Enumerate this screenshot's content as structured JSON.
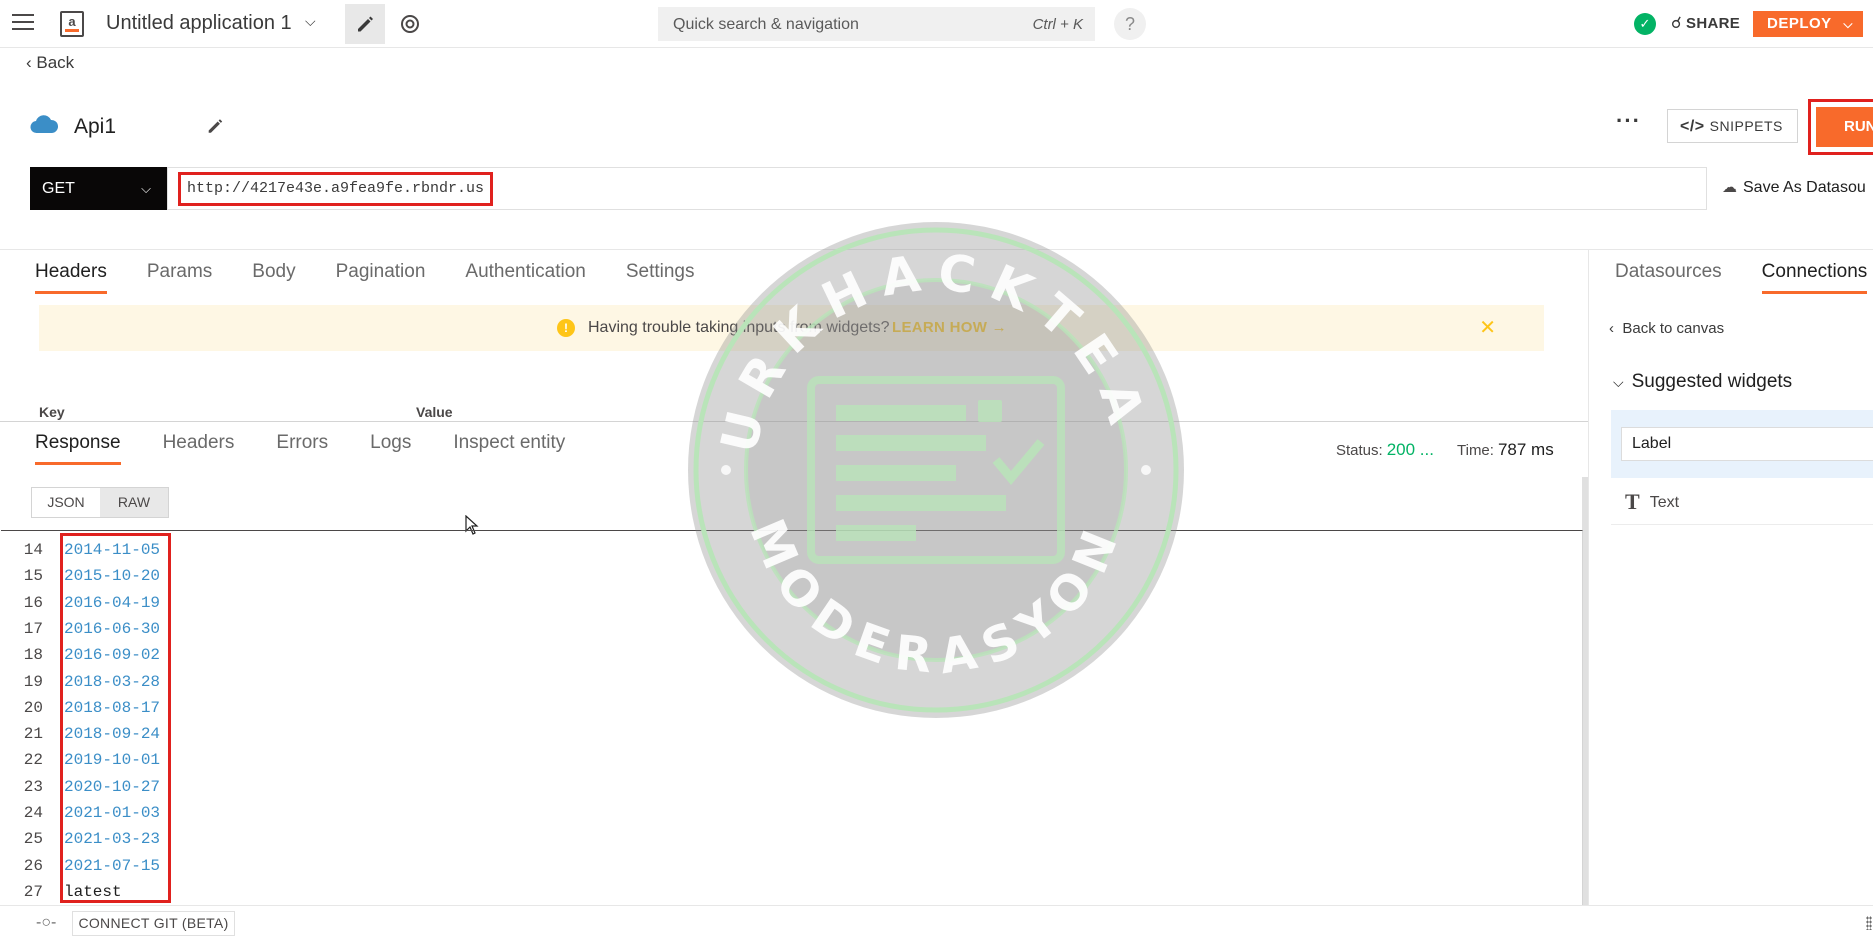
{
  "topbar": {
    "app_title": "Untitled application 1",
    "search_placeholder": "Quick search & navigation",
    "search_shortcut": "Ctrl + K",
    "help_label": "?",
    "share_label": "SHARE",
    "deploy_label": "DEPLOY"
  },
  "nav": {
    "back_label": "Back"
  },
  "api": {
    "name": "Api1",
    "snippets_label": "SNIPPETS",
    "run_label": "RUN",
    "method": "GET",
    "url": "http://4217e43e.a9fea9fe.rbndr.us",
    "save_datasource_label": "Save As Datasou"
  },
  "request": {
    "tabs": [
      "Headers",
      "Params",
      "Body",
      "Pagination",
      "Authentication",
      "Settings"
    ],
    "active_tab": "Headers",
    "banner": {
      "text": "Having trouble taking inputs from widgets?",
      "link": "LEARN HOW →"
    },
    "kv_headers": {
      "key": "Key",
      "value": "Value"
    }
  },
  "response": {
    "tabs": [
      "Response",
      "Headers",
      "Errors",
      "Logs",
      "Inspect entity"
    ],
    "active_tab": "Response",
    "status_label": "Status:",
    "status_value": "200 ...",
    "time_label": "Time:",
    "time_value": "787 ms",
    "formats": [
      "JSON",
      "RAW"
    ],
    "selected_format": "RAW",
    "lines": [
      {
        "n": "14",
        "text": "2014-11-05"
      },
      {
        "n": "15",
        "text": "2015-10-20"
      },
      {
        "n": "16",
        "text": "2016-04-19"
      },
      {
        "n": "17",
        "text": "2016-06-30"
      },
      {
        "n": "18",
        "text": "2016-09-02"
      },
      {
        "n": "19",
        "text": "2018-03-28"
      },
      {
        "n": "20",
        "text": "2018-08-17"
      },
      {
        "n": "21",
        "text": "2018-09-24"
      },
      {
        "n": "22",
        "text": "2019-10-01"
      },
      {
        "n": "23",
        "text": "2020-10-27"
      },
      {
        "n": "24",
        "text": "2021-01-03"
      },
      {
        "n": "25",
        "text": "2021-03-23"
      },
      {
        "n": "26",
        "text": "2021-07-15"
      },
      {
        "n": "27",
        "text": "latest"
      }
    ]
  },
  "sidebar": {
    "tabs": [
      "Datasources",
      "Connections"
    ],
    "active_tab": "Connections",
    "back_to_canvas": "Back to canvas",
    "suggested_title": "Suggested widgets",
    "widgets": [
      "Label",
      "Text"
    ]
  },
  "bottombar": {
    "git_label": "CONNECT GIT (BETA)"
  },
  "colors": {
    "accent": "#f86a2b",
    "highlight": "#e0211e",
    "success": "#03b365",
    "link_blue": "#3b8ec7"
  }
}
